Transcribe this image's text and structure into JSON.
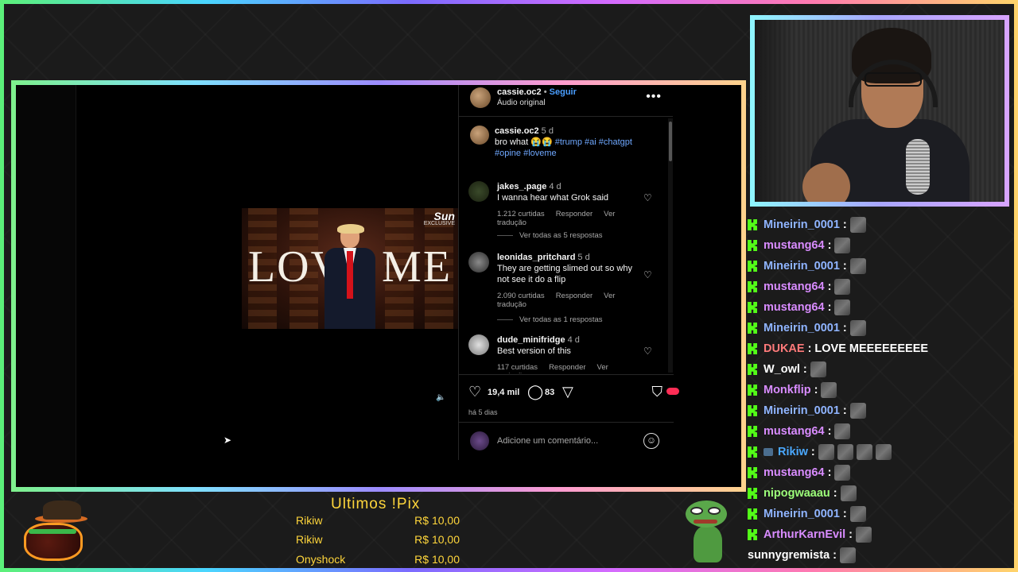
{
  "instagram": {
    "post_user": "cassie.oc2",
    "dot": "•",
    "follow_label": "Seguir",
    "audio_label": "Áudio original",
    "caption": {
      "user": "cassie.oc2",
      "time": "5 d",
      "text": "bro what 😭😭",
      "tags_line1": "#trump #ai #chatgpt",
      "tags_line2": "#opine #loveme"
    },
    "comments": [
      {
        "user": "jakes_.page",
        "time": "4 d",
        "text_line1": "I wanna hear what Grok said",
        "text_line2": "",
        "likes": "1.212 curtidas",
        "reply": "Responder",
        "translate": "Ver tradução",
        "view_replies": "Ver todas as 5 respostas"
      },
      {
        "user": "leonidas_pritchard",
        "time": "5 d",
        "text_line1": "They are getting slimed out so why",
        "text_line2": "not see it do a flip",
        "likes": "2.090 curtidas",
        "reply": "Responder",
        "translate": "Ver tradução",
        "view_replies": "Ver todas as 1 respostas"
      },
      {
        "user": "dude_minifridge",
        "time": "4 d",
        "text_line1": "Best version of this",
        "text_line2": "",
        "likes": "117 curtidas",
        "reply": "Responder",
        "translate": "Ver tradução",
        "view_replies": ""
      }
    ],
    "like_count": "19,4 mil",
    "comment_count": "83",
    "posted_ago": "há 5 dias",
    "add_comment_placeholder": "Adicione um comentário...",
    "video_overlay_text": "LOV   ME",
    "video_logo": "Sun",
    "video_logo_sub": "EXCLUSIVE"
  },
  "chat": {
    "accent_color": "#53fc18",
    "messages": [
      {
        "user": "Mineirin_0001",
        "color": "#8fb4ff",
        "text": "",
        "emotes": 1,
        "kick": true
      },
      {
        "user": "mustang64",
        "color": "#d98cff",
        "text": "",
        "emotes": 1,
        "kick": true
      },
      {
        "user": "Mineirin_0001",
        "color": "#8fb4ff",
        "text": "",
        "emotes": 1,
        "kick": true
      },
      {
        "user": "mustang64",
        "color": "#d98cff",
        "text": "",
        "emotes": 1,
        "kick": true
      },
      {
        "user": "mustang64",
        "color": "#d98cff",
        "text": "",
        "emotes": 1,
        "kick": true
      },
      {
        "user": "Mineirin_0001",
        "color": "#8fb4ff",
        "text": "",
        "emotes": 1,
        "kick": true
      },
      {
        "user": "DUKAE",
        "color": "#ff7a7a",
        "text": "LOVE MEEEEEEEEE",
        "emotes": 0,
        "kick": true
      },
      {
        "user": "W_owl",
        "color": "#ffffff",
        "text": "",
        "emotes": 1,
        "kick": true
      },
      {
        "user": "Monkflip",
        "color": "#d98cff",
        "text": "",
        "emotes": 1,
        "kick": true
      },
      {
        "user": "Mineirin_0001",
        "color": "#8fb4ff",
        "text": "",
        "emotes": 1,
        "kick": true
      },
      {
        "user": "mustang64",
        "color": "#d98cff",
        "text": "",
        "emotes": 1,
        "kick": true
      },
      {
        "user": "Rikiw",
        "color": "#4aa8ff",
        "text": "",
        "emotes": 4,
        "kick": true,
        "badge": true
      },
      {
        "user": "mustang64",
        "color": "#d98cff",
        "text": "",
        "emotes": 1,
        "kick": true
      },
      {
        "user": "nipogwaaau",
        "color": "#9dff7a",
        "text": "",
        "emotes": 1,
        "kick": true
      },
      {
        "user": "Mineirin_0001",
        "color": "#8fb4ff",
        "text": "",
        "emotes": 1,
        "kick": true
      },
      {
        "user": "ArthurKarnEvil",
        "color": "#d98cff",
        "text": "",
        "emotes": 1,
        "kick": true
      },
      {
        "user": "sunnygremista",
        "color": "#ffffff",
        "text": "",
        "emotes": 1,
        "kick": false
      }
    ]
  },
  "pix": {
    "title": "Ultimos !Pix",
    "color": "#ffd63b",
    "rows": [
      {
        "name": "Rikiw",
        "amount": "R$ 10,00"
      },
      {
        "name": "Rikiw",
        "amount": "R$ 10,00"
      },
      {
        "name": "Onyshock",
        "amount": "R$ 10,00"
      }
    ]
  }
}
